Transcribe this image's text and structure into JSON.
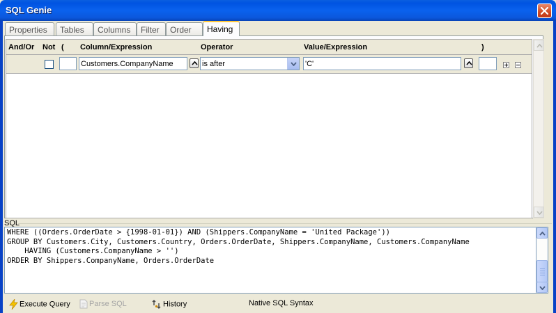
{
  "window": {
    "title": "SQL Genie"
  },
  "tabs": [
    {
      "label": "Properties",
      "active": false
    },
    {
      "label": "Tables",
      "active": false
    },
    {
      "label": "Columns",
      "active": false
    },
    {
      "label": "Filter",
      "active": false
    },
    {
      "label": "Order",
      "active": false
    },
    {
      "label": "Having",
      "active": true
    }
  ],
  "grid": {
    "headers": {
      "and_or": "And/Or",
      "not": "Not",
      "open_paren": "(",
      "column": "Column/Expression",
      "operator": "Operator",
      "value": "Value/Expression",
      "close_paren": ")"
    },
    "row": {
      "and_or": "",
      "not_checked": false,
      "open_paren": "",
      "column": "Customers.CompanyName",
      "operator": "is after",
      "value": "'C'",
      "close_paren": ""
    }
  },
  "sql": {
    "label": "SQL",
    "text": "WHERE ((Orders.OrderDate > {1998-01-01}) AND (Shippers.CompanyName = 'United Package'))\nGROUP BY Customers.City, Customers.Country, Orders.OrderDate, Shippers.CompanyName, Customers.CompanyName\n    HAVING (Customers.CompanyName > '')\nORDER BY Shippers.CompanyName, Orders.OrderDate"
  },
  "toolbar": {
    "execute_label": "Execute Query",
    "parse_label": "Parse SQL",
    "history_label": "History",
    "status_label": "Native SQL Syntax"
  },
  "icons": {
    "close": "close-icon",
    "execute": "lightning-icon",
    "parse": "document-icon",
    "history": "history-icon",
    "add": "plus-icon",
    "remove": "minus-icon"
  },
  "colors": {
    "titlebar": "#0053e1",
    "active_tab_accent": "#ffc83c",
    "window_bg": "#ece9d8"
  }
}
